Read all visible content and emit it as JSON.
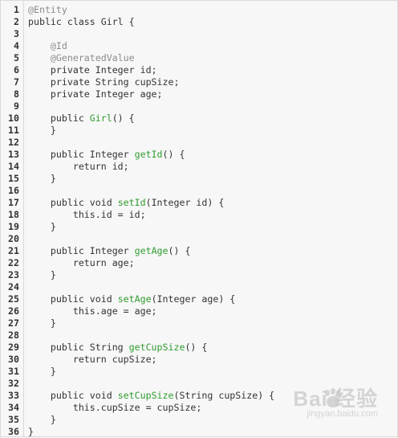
{
  "editor": {
    "lines": [
      {
        "n": "1",
        "tokens": [
          {
            "t": "@Entity",
            "c": "annotation"
          }
        ]
      },
      {
        "n": "2",
        "tokens": [
          {
            "t": "public class Girl {",
            "c": "plain"
          }
        ]
      },
      {
        "n": "3",
        "tokens": []
      },
      {
        "n": "4",
        "tokens": [
          {
            "t": "    @Id",
            "c": "annotation"
          }
        ]
      },
      {
        "n": "5",
        "tokens": [
          {
            "t": "    @GeneratedValue",
            "c": "annotation"
          }
        ]
      },
      {
        "n": "6",
        "tokens": [
          {
            "t": "    private Integer id;",
            "c": "plain"
          }
        ]
      },
      {
        "n": "7",
        "tokens": [
          {
            "t": "    private String cupSize;",
            "c": "plain"
          }
        ]
      },
      {
        "n": "8",
        "tokens": [
          {
            "t": "    private Integer age;",
            "c": "plain"
          }
        ]
      },
      {
        "n": "9",
        "tokens": []
      },
      {
        "n": "10",
        "tokens": [
          {
            "t": "    public ",
            "c": "plain"
          },
          {
            "t": "Girl",
            "c": "fn"
          },
          {
            "t": "() {",
            "c": "plain"
          }
        ]
      },
      {
        "n": "11",
        "tokens": [
          {
            "t": "    }",
            "c": "plain"
          }
        ]
      },
      {
        "n": "12",
        "tokens": []
      },
      {
        "n": "13",
        "tokens": [
          {
            "t": "    public Integer ",
            "c": "plain"
          },
          {
            "t": "getId",
            "c": "fn"
          },
          {
            "t": "() {",
            "c": "plain"
          }
        ]
      },
      {
        "n": "14",
        "tokens": [
          {
            "t": "        return id;",
            "c": "plain"
          }
        ]
      },
      {
        "n": "15",
        "tokens": [
          {
            "t": "    }",
            "c": "plain"
          }
        ]
      },
      {
        "n": "16",
        "tokens": []
      },
      {
        "n": "17",
        "tokens": [
          {
            "t": "    public void ",
            "c": "plain"
          },
          {
            "t": "setId",
            "c": "fn"
          },
          {
            "t": "(Integer id) {",
            "c": "plain"
          }
        ]
      },
      {
        "n": "18",
        "tokens": [
          {
            "t": "        this.id = id;",
            "c": "plain"
          }
        ]
      },
      {
        "n": "19",
        "tokens": [
          {
            "t": "    }",
            "c": "plain"
          }
        ]
      },
      {
        "n": "20",
        "tokens": []
      },
      {
        "n": "21",
        "tokens": [
          {
            "t": "    public Integer ",
            "c": "plain"
          },
          {
            "t": "getAge",
            "c": "fn"
          },
          {
            "t": "() {",
            "c": "plain"
          }
        ]
      },
      {
        "n": "22",
        "tokens": [
          {
            "t": "        return age;",
            "c": "plain"
          }
        ]
      },
      {
        "n": "23",
        "tokens": [
          {
            "t": "    }",
            "c": "plain"
          }
        ]
      },
      {
        "n": "24",
        "tokens": []
      },
      {
        "n": "25",
        "tokens": [
          {
            "t": "    public void ",
            "c": "plain"
          },
          {
            "t": "setAge",
            "c": "fn"
          },
          {
            "t": "(Integer age) {",
            "c": "plain"
          }
        ]
      },
      {
        "n": "26",
        "tokens": [
          {
            "t": "        this.age = age;",
            "c": "plain"
          }
        ]
      },
      {
        "n": "27",
        "tokens": [
          {
            "t": "    }",
            "c": "plain"
          }
        ]
      },
      {
        "n": "28",
        "tokens": []
      },
      {
        "n": "29",
        "tokens": [
          {
            "t": "    public String ",
            "c": "plain"
          },
          {
            "t": "getCupSize",
            "c": "fn"
          },
          {
            "t": "() {",
            "c": "plain"
          }
        ]
      },
      {
        "n": "30",
        "tokens": [
          {
            "t": "        return cupSize;",
            "c": "plain"
          }
        ]
      },
      {
        "n": "31",
        "tokens": [
          {
            "t": "    }",
            "c": "plain"
          }
        ]
      },
      {
        "n": "32",
        "tokens": []
      },
      {
        "n": "33",
        "tokens": [
          {
            "t": "    public void ",
            "c": "plain"
          },
          {
            "t": "setCupSize",
            "c": "fn"
          },
          {
            "t": "(String cupSize) {",
            "c": "plain"
          }
        ]
      },
      {
        "n": "34",
        "tokens": [
          {
            "t": "        this.cupSize = cupSize;",
            "c": "plain"
          }
        ]
      },
      {
        "n": "35",
        "tokens": [
          {
            "t": "    }",
            "c": "plain"
          }
        ]
      },
      {
        "n": "36",
        "tokens": [
          {
            "t": "}",
            "c": "plain"
          }
        ]
      }
    ]
  },
  "watermark": {
    "brand": "Bai  经验",
    "sub": "jingyan.baidu.com",
    "icon": "baidu-paw-icon"
  },
  "colors": {
    "annotation": "#8c8c8c",
    "function_name": "#2f9c2f",
    "text": "#333333",
    "background": "#f7f7f7"
  }
}
